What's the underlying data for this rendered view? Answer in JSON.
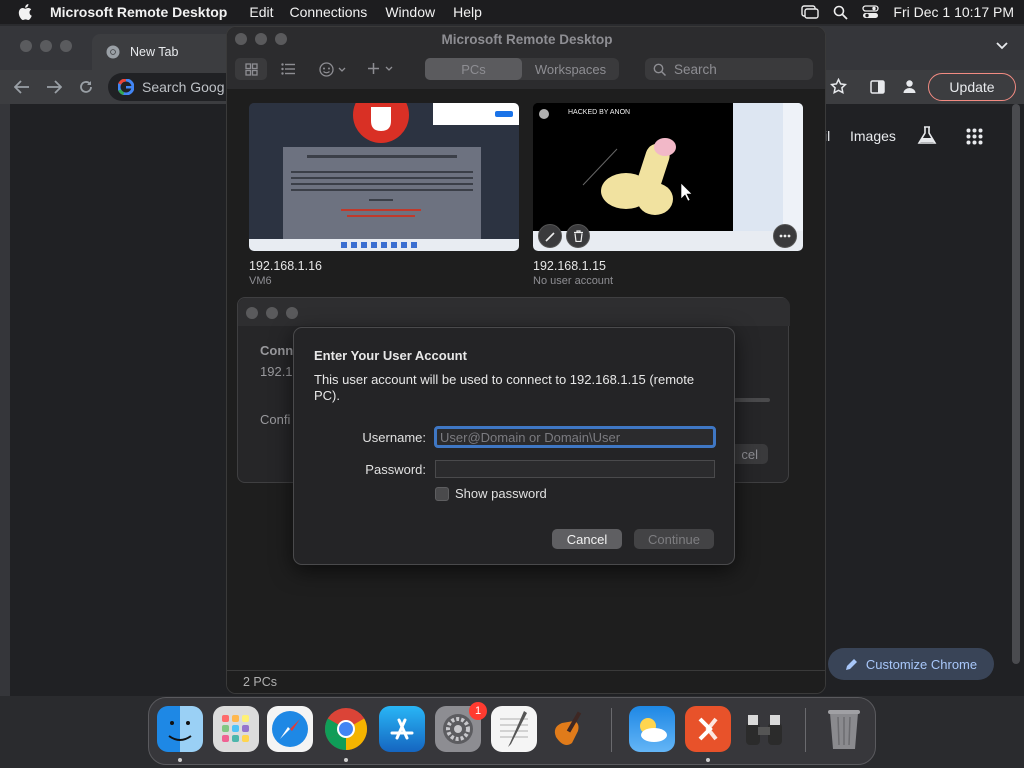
{
  "menubar": {
    "app_name": "Microsoft Remote Desktop",
    "items": [
      "Edit",
      "Connections",
      "Window",
      "Help"
    ],
    "clock": "Fri Dec 1  10:17 PM"
  },
  "chrome": {
    "tab_title": "New Tab",
    "omnibox_text": "Search Goog",
    "update_label": "Update",
    "gmail_label": "il",
    "images_label": "Images",
    "customize_label": "Customize Chrome"
  },
  "rd": {
    "window_title": "Microsoft Remote Desktop",
    "seg_pcs": "PCs",
    "seg_workspaces": "Workspaces",
    "search_placeholder": "Search",
    "footer": "2 PCs",
    "pcs": [
      {
        "name": "192.168.1.16",
        "subtitle": "VM6"
      },
      {
        "name": "192.168.1.15",
        "subtitle": "No user account"
      }
    ],
    "thumb2_text": "HACKED BY ANON"
  },
  "sheet": {
    "conn_label": "Conn",
    "ip_label": "192.1",
    "config_label": "Confi",
    "cancel_frag": "cel"
  },
  "dialog": {
    "title": "Enter Your User Account",
    "message": "This user account will be used to connect to 192.168.1.15 (remote PC).",
    "username_label": "Username:",
    "username_placeholder": "User@Domain or Domain\\User",
    "password_label": "Password:",
    "show_password_label": "Show password",
    "cancel_label": "Cancel",
    "continue_label": "Continue"
  },
  "dock": {
    "badge_settings": "1",
    "apps": [
      "finder",
      "launchpad",
      "safari",
      "chrome",
      "app-store",
      "system-settings",
      "textedit",
      "garageband",
      "weather",
      "remote-desktop",
      "preview-binoculars",
      "trash"
    ]
  },
  "colors": {
    "accent_blue": "#3f77c4",
    "update_border": "#f28b82"
  }
}
